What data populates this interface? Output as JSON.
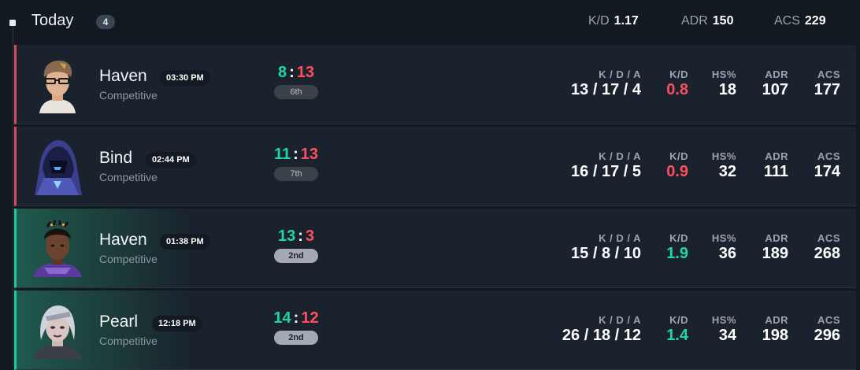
{
  "header": {
    "title": "Today",
    "count": "4",
    "stats": [
      {
        "label": "K/D",
        "value": "1.17"
      },
      {
        "label": "ADR",
        "value": "150"
      },
      {
        "label": "ACS",
        "value": "229"
      }
    ]
  },
  "columns": {
    "kda": "K / D / A",
    "kd": "K/D",
    "hs": "HS%",
    "adr": "ADR",
    "acs": "ACS"
  },
  "matches": [
    {
      "map": "Haven",
      "time": "03:30 PM",
      "mode": "Competitive",
      "score_us": "8",
      "score_them": "13",
      "placement": "6th",
      "kda": "13 / 17 / 4",
      "kd": "0.8",
      "hs": "18",
      "adr": "107",
      "acs": "177",
      "result": "loss"
    },
    {
      "map": "Bind",
      "time": "02:44 PM",
      "mode": "Competitive",
      "score_us": "11",
      "score_them": "13",
      "placement": "7th",
      "kda": "16 / 17 / 5",
      "kd": "0.9",
      "hs": "32",
      "adr": "111",
      "acs": "174",
      "result": "loss"
    },
    {
      "map": "Haven",
      "time": "01:38 PM",
      "mode": "Competitive",
      "score_us": "13",
      "score_them": "3",
      "placement": "2nd",
      "kda": "15 / 8 / 10",
      "kd": "1.9",
      "hs": "36",
      "adr": "189",
      "acs": "268",
      "result": "win"
    },
    {
      "map": "Pearl",
      "time": "12:18 PM",
      "mode": "Competitive",
      "score_us": "14",
      "score_them": "12",
      "placement": "2nd",
      "kda": "26 / 18 / 12",
      "kd": "1.4",
      "hs": "34",
      "adr": "198",
      "acs": "296",
      "result": "win"
    }
  ],
  "colors": {
    "win": "#1fd7a0",
    "loss": "#ff4f5e",
    "background": "#121920",
    "card": "#1a232d"
  },
  "icons": {
    "timeline": "square-bullet-icon",
    "agent": "agent-portrait-icon"
  }
}
